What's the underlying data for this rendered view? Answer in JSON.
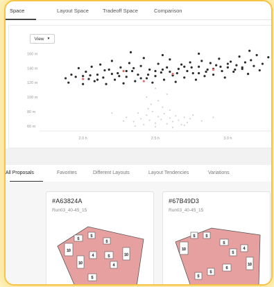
{
  "top_tabs": [
    {
      "label": "Space",
      "active": true
    },
    {
      "label": "Layout Space",
      "active": false
    },
    {
      "label": "Tradeoff Space",
      "active": false
    },
    {
      "label": "Comparison",
      "active": false
    }
  ],
  "view_button": {
    "label": "View",
    "icon": "chevron-down-icon"
  },
  "chart_data": {
    "type": "scatter",
    "y_ticks": [
      "160 m",
      "140 m",
      "120 m",
      "100 m",
      "80 m",
      "60 m"
    ],
    "x_ticks": [
      "2.0 h",
      "2.5 h",
      "3.0 h"
    ],
    "xlim": [
      1.7,
      3.3
    ],
    "ylim": [
      55,
      170
    ],
    "series": [
      {
        "color": "#2b2b2b",
        "points": [
          [
            1.88,
            126
          ],
          [
            1.9,
            120
          ],
          [
            1.92,
            131
          ],
          [
            1.95,
            128
          ],
          [
            1.97,
            140
          ],
          [
            2.0,
            118
          ],
          [
            2.02,
            135
          ],
          [
            2.04,
            125
          ],
          [
            2.06,
            142
          ],
          [
            2.08,
            122
          ],
          [
            2.1,
            131
          ],
          [
            2.12,
            145
          ],
          [
            2.14,
            127
          ],
          [
            2.16,
            118
          ],
          [
            2.18,
            138
          ],
          [
            2.2,
            150
          ],
          [
            2.22,
            124
          ],
          [
            2.24,
            133
          ],
          [
            2.26,
            141
          ],
          [
            2.28,
            119
          ],
          [
            2.3,
            128
          ],
          [
            2.32,
            147
          ],
          [
            2.34,
            136
          ],
          [
            2.36,
            122
          ],
          [
            2.38,
            131
          ],
          [
            2.4,
            143
          ],
          [
            2.42,
            154
          ],
          [
            2.44,
            126
          ],
          [
            2.46,
            138
          ],
          [
            2.48,
            120
          ],
          [
            2.5,
            129
          ],
          [
            2.52,
            146
          ],
          [
            2.54,
            134
          ],
          [
            2.56,
            124
          ],
          [
            2.58,
            141
          ],
          [
            2.6,
            152
          ],
          [
            2.62,
            130
          ],
          [
            2.64,
            121
          ],
          [
            2.66,
            139
          ],
          [
            2.68,
            145
          ],
          [
            2.7,
            127
          ],
          [
            2.72,
            136
          ],
          [
            2.74,
            148
          ],
          [
            2.76,
            133
          ],
          [
            2.78,
            124
          ],
          [
            2.8,
            142
          ],
          [
            2.82,
            150
          ],
          [
            2.84,
            129
          ],
          [
            2.86,
            138
          ],
          [
            2.88,
            147
          ],
          [
            2.9,
            131
          ],
          [
            2.92,
            144
          ],
          [
            2.94,
            153
          ],
          [
            2.96,
            136
          ],
          [
            2.98,
            127
          ],
          [
            3.0,
            141
          ],
          [
            3.02,
            149
          ],
          [
            3.04,
            135
          ],
          [
            3.06,
            144
          ],
          [
            3.08,
            156
          ],
          [
            3.1,
            139
          ],
          [
            3.12,
            148
          ],
          [
            3.14,
            132
          ],
          [
            3.16,
            151
          ],
          [
            3.18,
            143
          ],
          [
            3.2,
            158
          ],
          [
            3.22,
            137
          ],
          [
            3.24,
            146
          ],
          [
            2.05,
            130
          ],
          [
            2.15,
            137
          ],
          [
            2.25,
            129
          ],
          [
            2.35,
            140
          ],
          [
            2.45,
            131
          ],
          [
            2.55,
            138
          ],
          [
            2.65,
            133
          ],
          [
            2.75,
            141
          ],
          [
            2.85,
            135
          ],
          [
            2.95,
            142
          ],
          [
            3.05,
            138
          ],
          [
            2.0,
            129
          ],
          [
            2.1,
            124
          ],
          [
            2.2,
            132
          ],
          [
            2.3,
            136
          ],
          [
            2.4,
            126
          ],
          [
            2.5,
            136
          ],
          [
            2.6,
            135
          ],
          [
            2.7,
            142
          ],
          [
            2.8,
            133
          ],
          [
            2.9,
            139
          ],
          [
            3.0,
            146
          ],
          [
            3.1,
            141
          ],
          [
            2.33,
            162
          ],
          [
            2.55,
            158
          ],
          [
            2.8,
            160
          ],
          [
            3.15,
            164
          ],
          [
            3.28,
            155
          ]
        ]
      },
      {
        "color": "#e07070",
        "points": [
          [
            2.0,
            125
          ],
          [
            2.28,
            136
          ],
          [
            2.62,
            132
          ],
          [
            2.9,
            138
          ],
          [
            2.42,
            122
          ]
        ]
      },
      {
        "color": "#c3c9d1",
        "points": [
          [
            2.3,
            72
          ],
          [
            2.35,
            66
          ],
          [
            2.38,
            78
          ],
          [
            2.4,
            70
          ],
          [
            2.42,
            62
          ],
          [
            2.44,
            75
          ],
          [
            2.46,
            68
          ],
          [
            2.48,
            80
          ],
          [
            2.5,
            64
          ],
          [
            2.52,
            73
          ],
          [
            2.54,
            69
          ],
          [
            2.56,
            77
          ],
          [
            2.58,
            63
          ],
          [
            2.6,
            71
          ],
          [
            2.62,
            66
          ],
          [
            2.64,
            74
          ],
          [
            2.66,
            68
          ],
          [
            2.68,
            62
          ],
          [
            2.7,
            72
          ],
          [
            2.72,
            65
          ],
          [
            2.74,
            70
          ],
          [
            2.76,
            75
          ],
          [
            2.45,
            84
          ],
          [
            2.55,
            86
          ],
          [
            2.36,
            60
          ],
          [
            2.5,
            59
          ],
          [
            2.62,
            58
          ],
          [
            2.7,
            61
          ],
          [
            2.2,
            78
          ],
          [
            2.82,
            67
          ],
          [
            2.9,
            72
          ],
          [
            2.28,
            67
          ],
          [
            2.6,
            82
          ],
          [
            2.47,
            90
          ],
          [
            2.52,
            95
          ],
          [
            2.58,
            104
          ],
          [
            2.5,
            112
          ],
          [
            2.44,
            100
          ]
        ]
      }
    ]
  },
  "bottom_tabs": [
    {
      "label": "All Proposals",
      "active": true
    },
    {
      "label": "Favorites",
      "active": false
    },
    {
      "label": "Different Layouts",
      "active": false
    },
    {
      "label": "Layout Tendencies",
      "active": false
    },
    {
      "label": "Variations",
      "active": false
    }
  ],
  "proposals": [
    {
      "id": "#A63824A",
      "run": "Run03_40-45_15",
      "rooms": [
        "10",
        "5",
        "5",
        "5",
        "5",
        "10",
        "4",
        "4",
        "10",
        "5"
      ]
    },
    {
      "id": "#67B49D3",
      "run": "Run03_40-45_15",
      "rooms": [
        "10",
        "5",
        "5",
        "5",
        "4",
        "10",
        "5",
        "6",
        "5",
        "5"
      ]
    }
  ],
  "colors": {
    "accent_border": "#f6c343",
    "floor_fill": "#e7a0a0",
    "dark_point": "#2b2b2b",
    "red_point": "#e07070",
    "gray_point": "#c3c9d1"
  }
}
